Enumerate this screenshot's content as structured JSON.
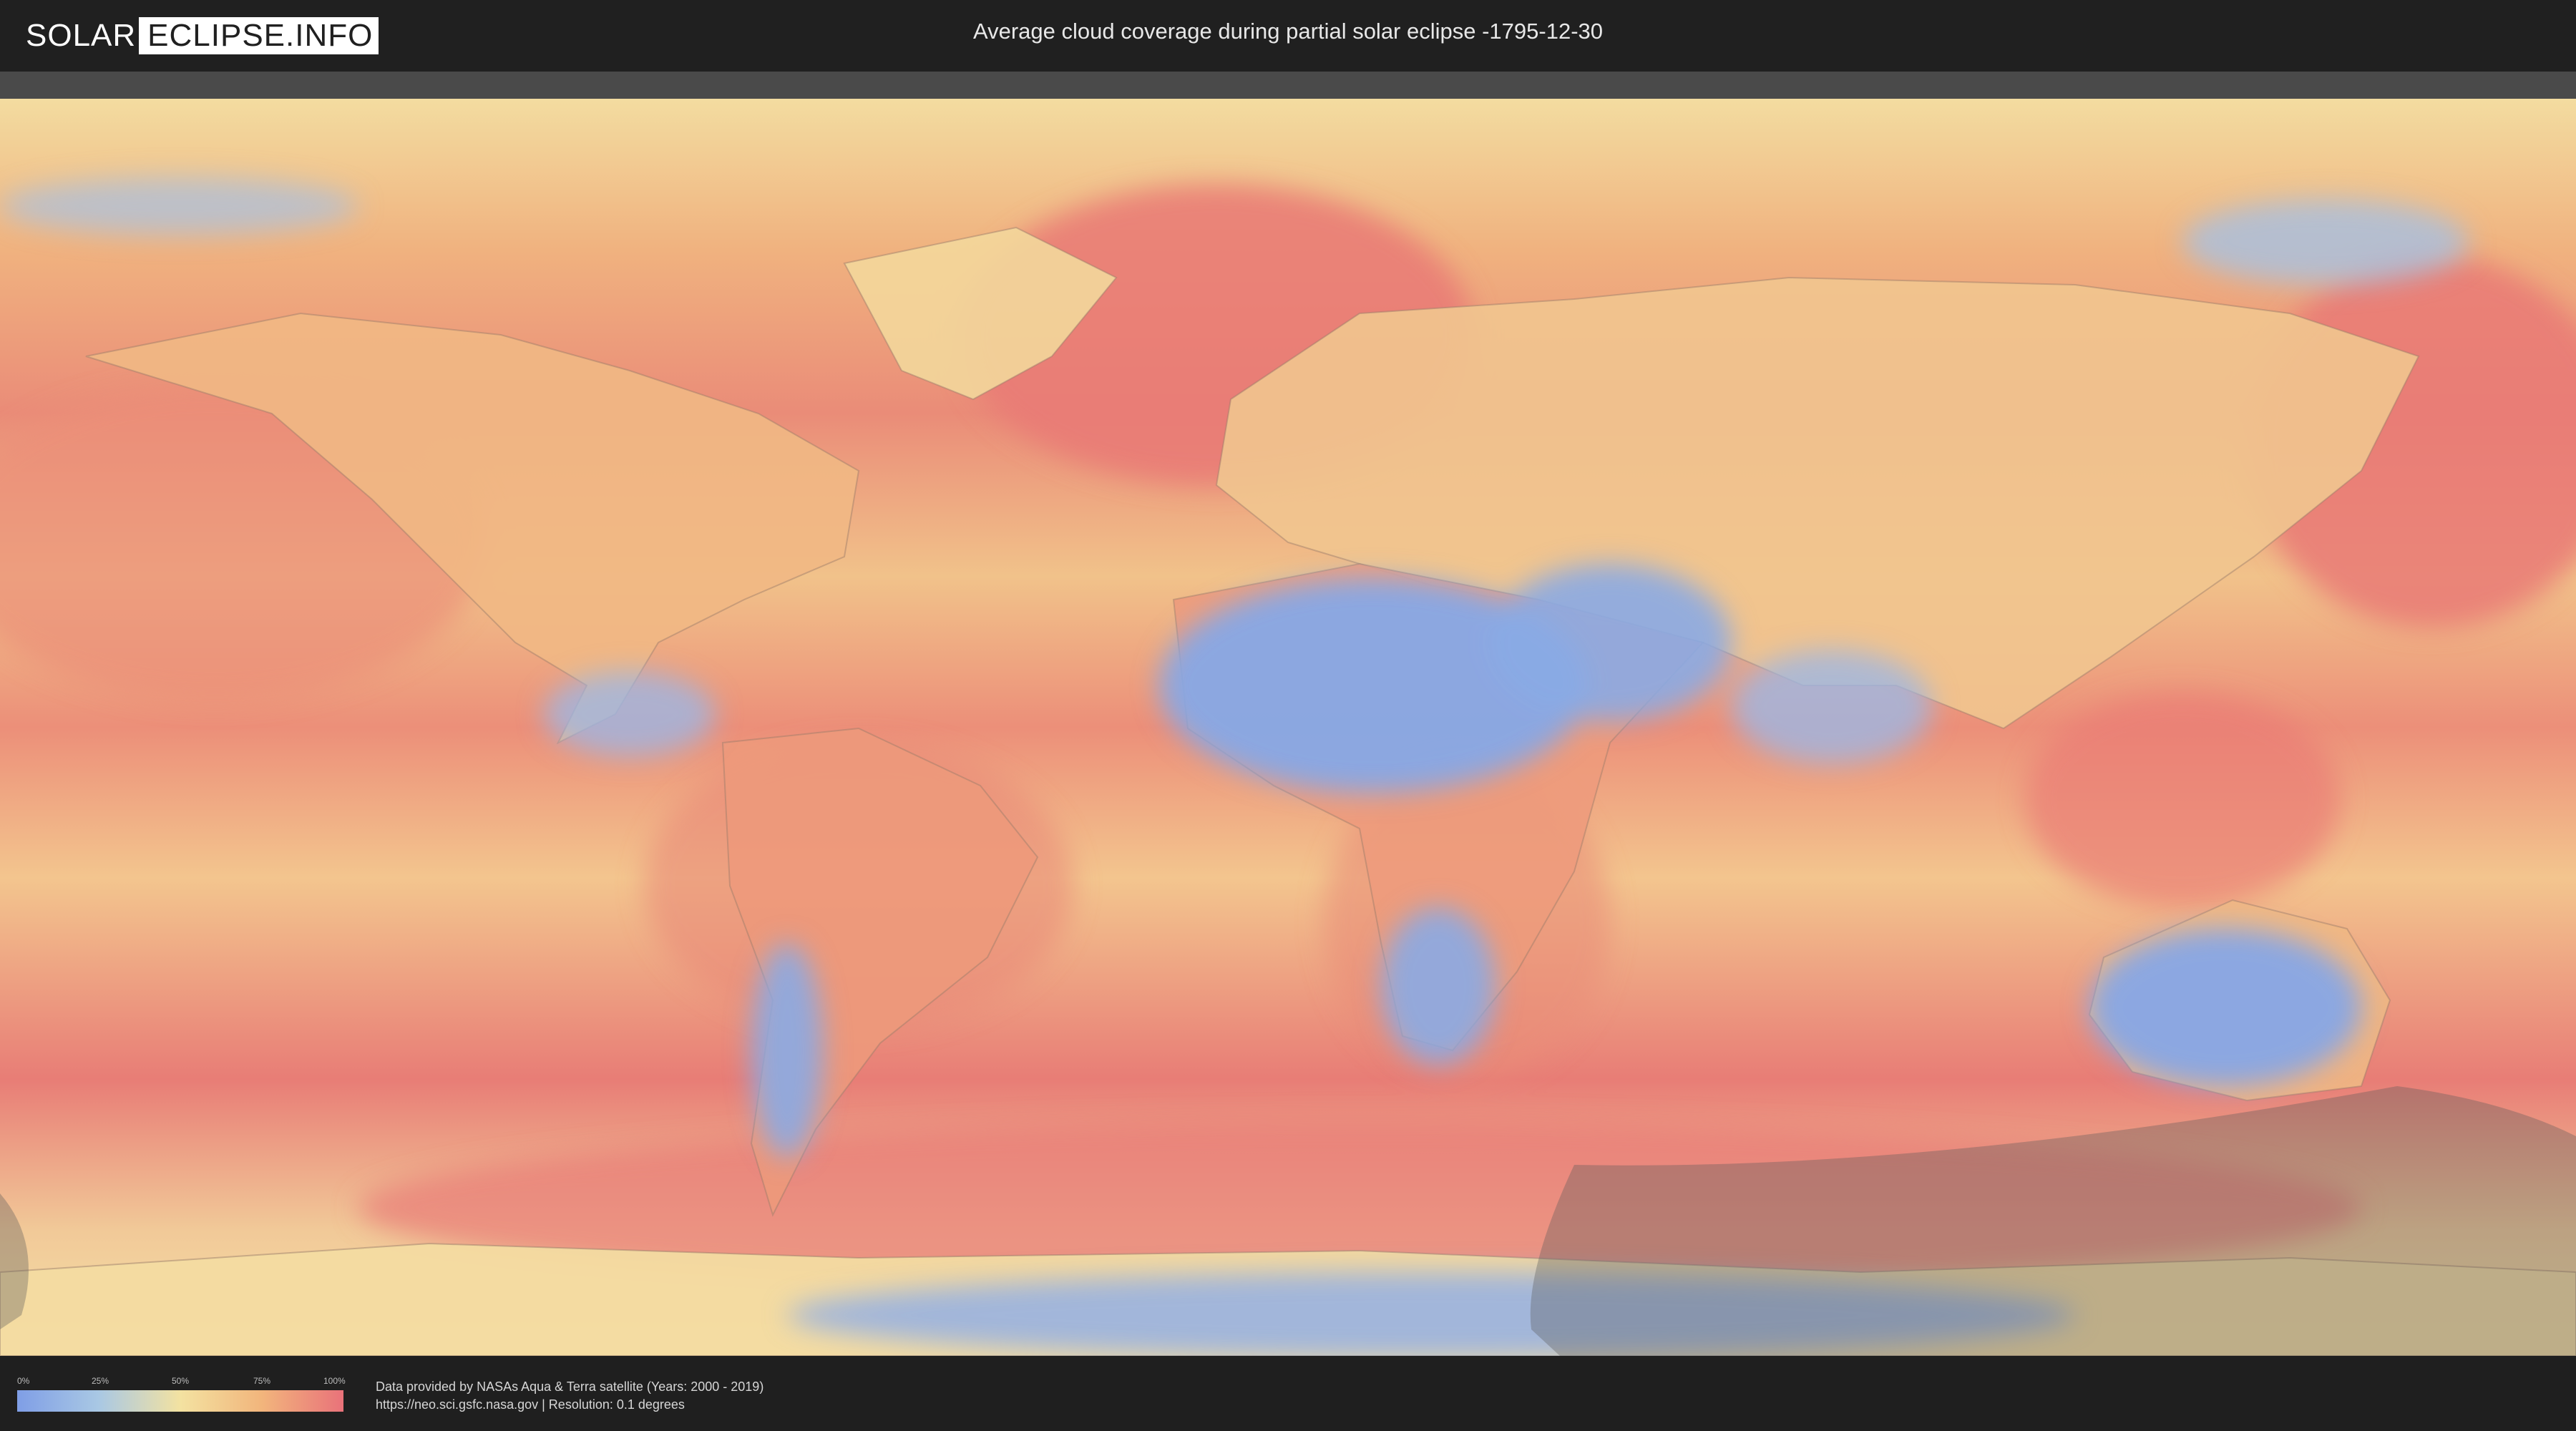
{
  "header": {
    "logo_part1": "SOLAR",
    "logo_part2": "ECLIPSE.INFO",
    "title": "Average cloud coverage during partial solar eclipse -1795-12-30"
  },
  "legend": {
    "ticks": [
      "0%",
      "25%",
      "50%",
      "75%",
      "100%"
    ],
    "colors": [
      "#7f9ee6",
      "#a9c8e4",
      "#f3e2a1",
      "#f2b57c",
      "#e9727a"
    ]
  },
  "footer": {
    "line1": "Data provided by NASAs Aqua & Terra satellite (Years: 2000 - 2019)",
    "line2": "https://neo.sci.gsfc.nasa.gov | Resolution: 0.1 degrees"
  },
  "map": {
    "colors": {
      "ocean_high": "#e87b76",
      "mid": "#f2b07e",
      "low": "#f2dc9c",
      "clear": "#86a8e6",
      "eclipse_shade": "#5a5a5a"
    }
  }
}
